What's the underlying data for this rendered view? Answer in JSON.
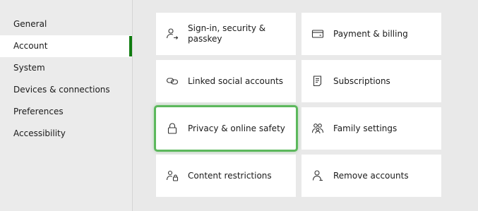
{
  "sidebar": {
    "items": [
      {
        "label": "General"
      },
      {
        "label": "Account"
      },
      {
        "label": "System"
      },
      {
        "label": "Devices & connections"
      },
      {
        "label": "Preferences"
      },
      {
        "label": "Accessibility"
      }
    ],
    "active_index": 1,
    "accent_color": "#107c10"
  },
  "tiles": [
    {
      "label": "Sign-in, security & passkey",
      "icon": "person-key-icon"
    },
    {
      "label": "Payment & billing",
      "icon": "credit-card-icon"
    },
    {
      "label": "Linked social accounts",
      "icon": "link-icon"
    },
    {
      "label": "Subscriptions",
      "icon": "receipt-icon"
    },
    {
      "label": "Privacy & online safety",
      "icon": "lock-icon"
    },
    {
      "label": "Family settings",
      "icon": "family-icon"
    },
    {
      "label": "Content restrictions",
      "icon": "person-lock-icon"
    },
    {
      "label": "Remove accounts",
      "icon": "person-icon"
    }
  ],
  "focused_tile_index": 4,
  "focus_color": "#5cb85c"
}
